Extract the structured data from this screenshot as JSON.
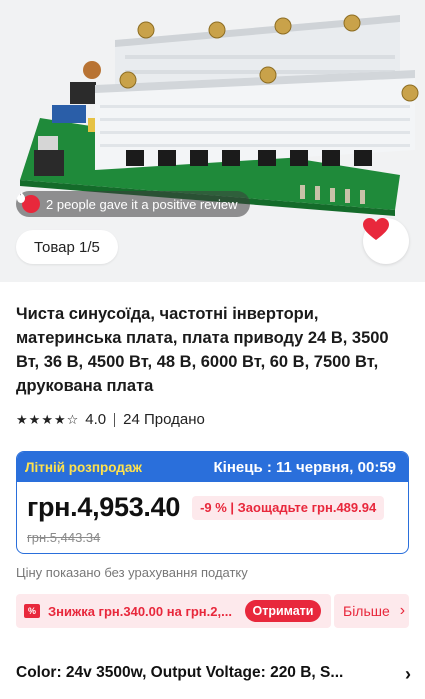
{
  "hero": {
    "review_text": "2 people gave it a positive review",
    "page_indicator": "Товар 1/5"
  },
  "product": {
    "title": "Чиста синусоїда, частотні інвертори, материнська плата, плата приводу 24 В, 3500 Вт, 36 В, 4500 Вт, 48 В, 6000 Вт, 60 В, 7500 Вт, друкована плата",
    "rating": {
      "value": "4.0",
      "stars": 4,
      "max_stars": 5
    },
    "sold": "24 Продано"
  },
  "sale": {
    "label": "Літній розпродаж",
    "end_text": "Кінець :  11 червня, 00:59",
    "price": "грн.4,953.40",
    "discount": "-9 % | Заощадьте грн.489.94",
    "old_price": "грн.5,443.34"
  },
  "tax_note": "Ціну показано без урахування податку",
  "coupon": {
    "icon_text": "%",
    "text": "Знижка грн.340.00 на грн.2,...",
    "button": "Отримати",
    "more": "Більше"
  },
  "options": {
    "text": "Color: 24v 3500w, Output Voltage: 220 В, S..."
  },
  "colors": {
    "accent_blue": "#2a6fdb",
    "accent_red": "#e8283c",
    "sale_label": "#ffe24d",
    "coupon_bg": "#fde9ec"
  },
  "icons": [
    "flame-icon",
    "heart-icon",
    "star-icon",
    "chevron-right-icon",
    "coupon-icon"
  ]
}
